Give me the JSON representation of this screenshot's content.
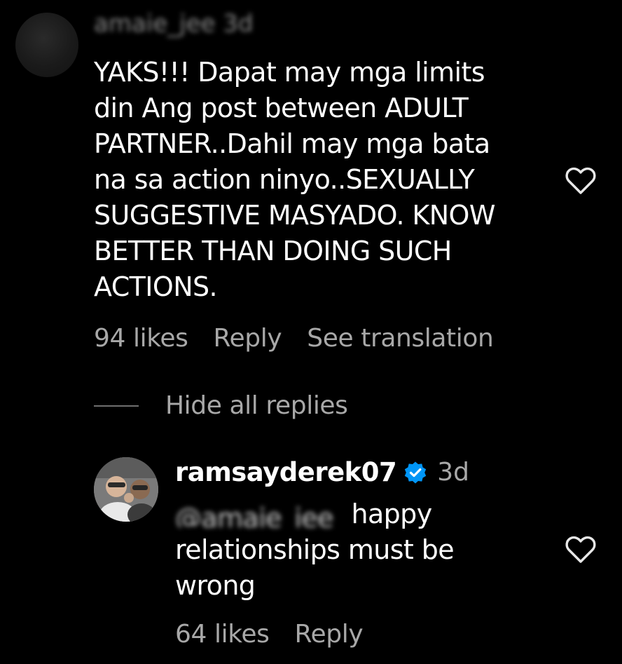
{
  "comment": {
    "username_obscured": "amaie_jee 3d",
    "text": "YAKS!!! Dapat may mga limits\ndin Ang post between ADULT\nPARTNER..Dahil may mga bata\nna sa action ninyo..SEXUALLY\nSUGGESTIVE MASYADO. KNOW\nBETTER THAN DOING SUCH\nACTIONS.",
    "likes": "94 likes",
    "reply_label": "Reply",
    "translate_label": "See translation",
    "like_icon": "heart-outline-icon"
  },
  "replies_toggle": {
    "label": "Hide all replies"
  },
  "reply": {
    "username": "ramsayderek07",
    "verified_icon": "verified-badge-icon",
    "verified_color": "#0095f6",
    "time": "3d",
    "mention_obscured": "@amaie_jee",
    "text_line1": "happy",
    "text_rest": "relationships must be\nwrong",
    "likes": "64 likes",
    "reply_label": "Reply",
    "like_icon": "heart-outline-icon"
  }
}
